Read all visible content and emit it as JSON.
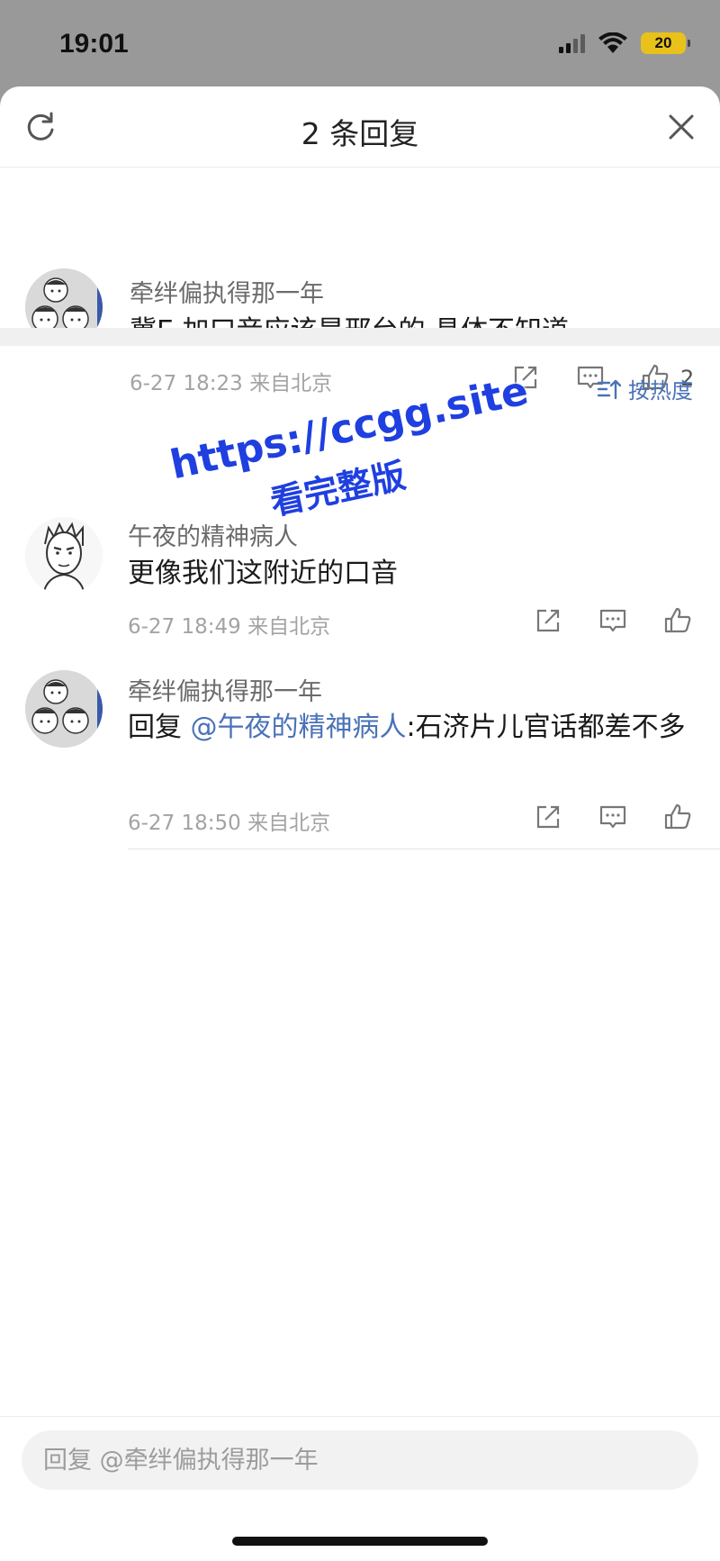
{
  "status_bar": {
    "time": "19:01",
    "battery": "20"
  },
  "sheet": {
    "title": "2 条回复"
  },
  "root_comment": {
    "username": "牵绊偏执得那一年",
    "content": "冀E  加口音应该是邢台的  具体不知道",
    "meta": "6-27 18:23 来自北京",
    "like_count": "2"
  },
  "sort": {
    "label": "按热度"
  },
  "replies": [
    {
      "username": "午夜的精神病人",
      "content": "更像我们这附近的口音",
      "meta": "6-27 18:49 来自北京"
    },
    {
      "username": "牵绊偏执得那一年",
      "content_prefix": "回复",
      "mention": "@午夜的精神病人",
      "content_suffix": ":石济片儿官话都差不多",
      "meta": "6-27 18:50 来自北京"
    }
  ],
  "watermark": {
    "line1": "https://ccgg.site",
    "line2": "看完整版"
  },
  "reply_box": {
    "placeholder": "回复 @牵绊偏执得那一年"
  },
  "colors": {
    "accent": "#4a72b8",
    "watermark": "#1f3fe0"
  }
}
